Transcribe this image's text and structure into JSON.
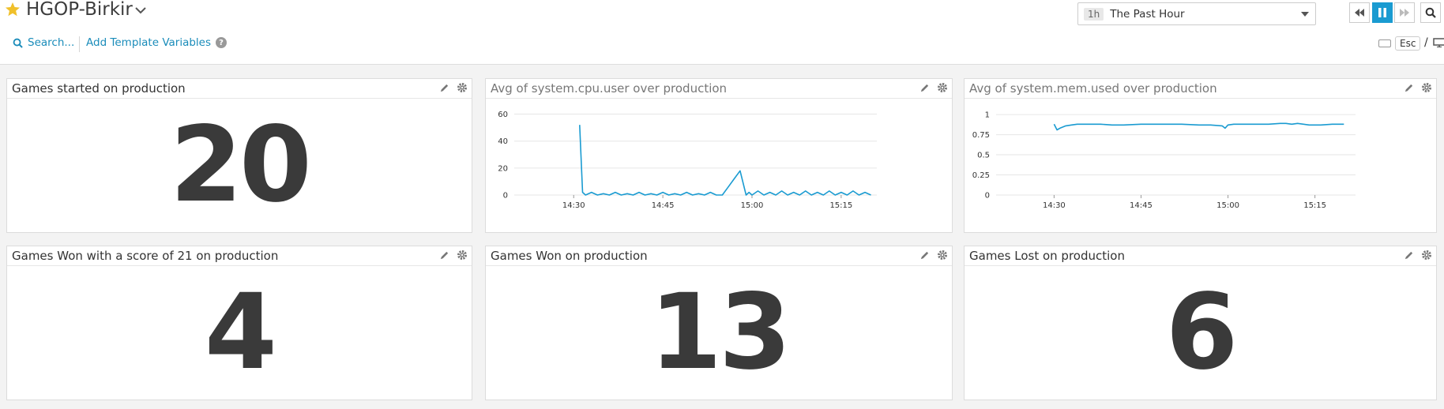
{
  "header": {
    "title": "HGOP-Birkir",
    "search_label": "Search...",
    "template_vars_label": "Add Template Variables",
    "help_icon": "?",
    "timeframe_badge": "1h",
    "timeframe_label": "The Past Hour",
    "esc_label": "Esc",
    "slash": "/",
    "accent_color": "#1a9bd1",
    "star_color": "#f0c02a"
  },
  "widgets": [
    {
      "title": "Games started on production",
      "value": "20"
    },
    {
      "title": "Avg of system.cpu.user over production"
    },
    {
      "title": "Avg of system.mem.used over production"
    },
    {
      "title": "Games Won with a score of 21 on production",
      "value": "4"
    },
    {
      "title": "Games Won on production",
      "value": "13"
    },
    {
      "title": "Games Lost on production",
      "value": "6"
    }
  ],
  "chart_data": [
    {
      "type": "line",
      "title": "Avg of system.cpu.user over production",
      "x_ticks": [
        "14:30",
        "14:45",
        "15:00",
        "15:15"
      ],
      "x_range": [
        "14:20",
        "15:21"
      ],
      "y_ticks": [
        "0",
        "20",
        "40",
        "60"
      ],
      "ylim": [
        0,
        65
      ],
      "grid": true,
      "color": "#1a9bd1",
      "x": [
        "14:31",
        "14:31.5",
        "14:32",
        "14:33",
        "14:34",
        "14:35",
        "14:36",
        "14:37",
        "14:38",
        "14:39",
        "14:40",
        "14:41",
        "14:42",
        "14:43",
        "14:44",
        "14:45",
        "14:46",
        "14:47",
        "14:48",
        "14:49",
        "14:50",
        "14:51",
        "14:52",
        "14:53",
        "14:54",
        "14:55",
        "14:56",
        "14:57",
        "14:58",
        "14:59",
        "14:59.5",
        "15:00",
        "15:01",
        "15:02",
        "15:03",
        "15:04",
        "15:05",
        "15:06",
        "15:07",
        "15:08",
        "15:09",
        "15:10",
        "15:11",
        "15:12",
        "15:13",
        "15:14",
        "15:15",
        "15:16",
        "15:17",
        "15:18",
        "15:19",
        "15:20"
      ],
      "values": [
        52,
        2,
        0,
        2,
        0,
        1,
        0,
        2,
        0,
        1,
        0,
        2,
        0,
        1,
        0,
        2,
        0,
        1,
        0,
        2,
        0,
        1,
        0,
        2,
        0,
        0,
        6,
        12,
        18,
        0,
        2,
        0,
        3,
        0,
        2,
        0,
        3,
        0,
        2,
        0,
        3,
        0,
        2,
        0,
        3,
        0,
        2,
        0,
        3,
        0,
        2,
        0
      ]
    },
    {
      "type": "line",
      "title": "Avg of system.mem.used over production",
      "x_ticks": [
        "14:30",
        "14:45",
        "15:00",
        "15:15"
      ],
      "x_range": [
        "14:20",
        "15:22"
      ],
      "y_ticks": [
        "0",
        "0.25",
        "0.5",
        "0.75",
        "1"
      ],
      "ylim": [
        0,
        1.05
      ],
      "grid": true,
      "color": "#1a9bd1",
      "x": [
        "14:30",
        "14:30.5",
        "14:31",
        "14:32",
        "14:33",
        "14:34",
        "14:36",
        "14:38",
        "14:40",
        "14:42",
        "14:45",
        "14:48",
        "14:50",
        "14:52",
        "14:55",
        "14:57",
        "14:59",
        "14:59.5",
        "15:00",
        "15:01",
        "15:03",
        "15:05",
        "15:07",
        "15:09",
        "15:10",
        "15:11",
        "15:12",
        "15:14",
        "15:16",
        "15:18",
        "15:20"
      ],
      "values": [
        0.88,
        0.81,
        0.83,
        0.86,
        0.87,
        0.88,
        0.88,
        0.88,
        0.87,
        0.87,
        0.88,
        0.88,
        0.88,
        0.88,
        0.87,
        0.87,
        0.86,
        0.83,
        0.87,
        0.88,
        0.88,
        0.88,
        0.88,
        0.89,
        0.89,
        0.88,
        0.89,
        0.87,
        0.87,
        0.88,
        0.88
      ]
    }
  ]
}
